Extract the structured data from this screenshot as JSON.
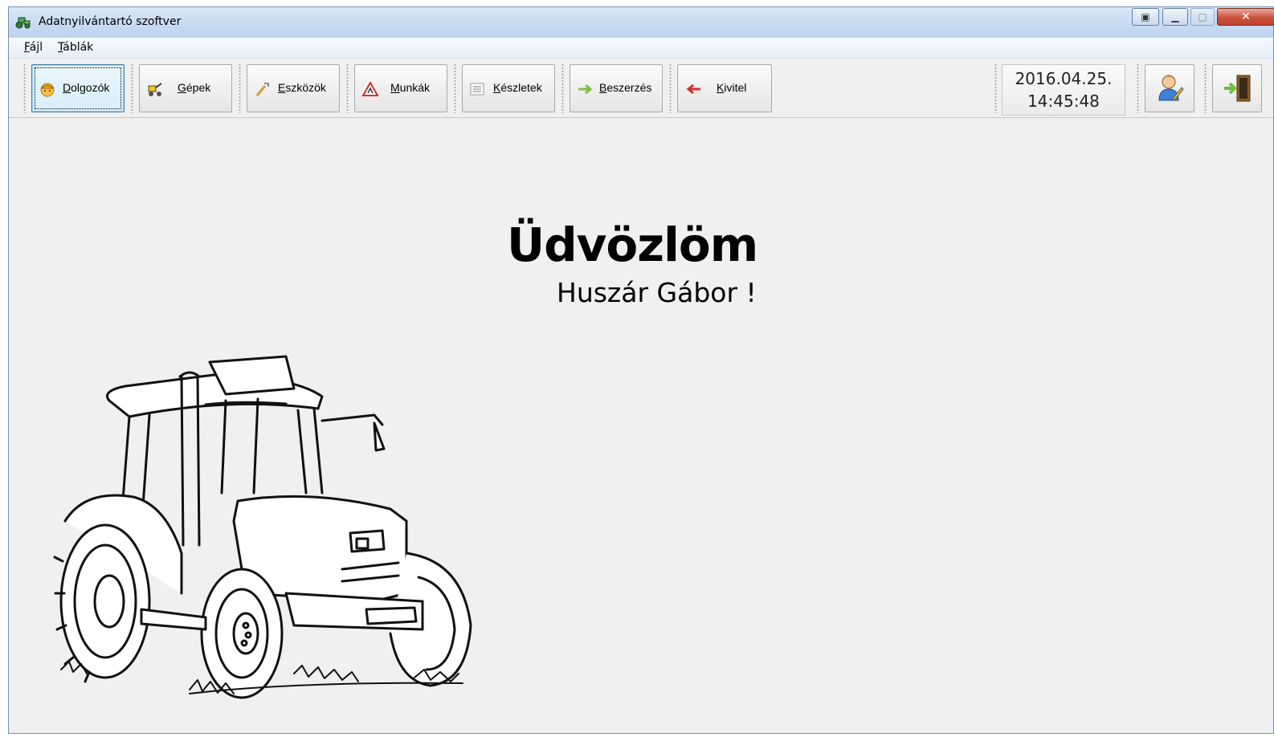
{
  "window": {
    "title": "Adatnyilvántartó szoftver"
  },
  "menu": {
    "items": [
      "Fájl",
      "Táblák"
    ]
  },
  "toolbar": {
    "buttons": [
      {
        "label": "Dolgozók",
        "icon": "worker-icon"
      },
      {
        "label": "Gépek",
        "icon": "machine-icon"
      },
      {
        "label": "Eszközök",
        "icon": "tool-icon"
      },
      {
        "label": "Munkák",
        "icon": "warning-icon"
      },
      {
        "label": "Készletek",
        "icon": "list-icon"
      },
      {
        "label": "Beszerzés",
        "icon": "arrow-right-icon"
      },
      {
        "label": "Kivitel",
        "icon": "arrow-left-icon"
      }
    ],
    "date": "2016.04.25.",
    "time": "14:45:48"
  },
  "main": {
    "welcome": "Üdvözlöm",
    "user": "Huszár Gábor !"
  }
}
